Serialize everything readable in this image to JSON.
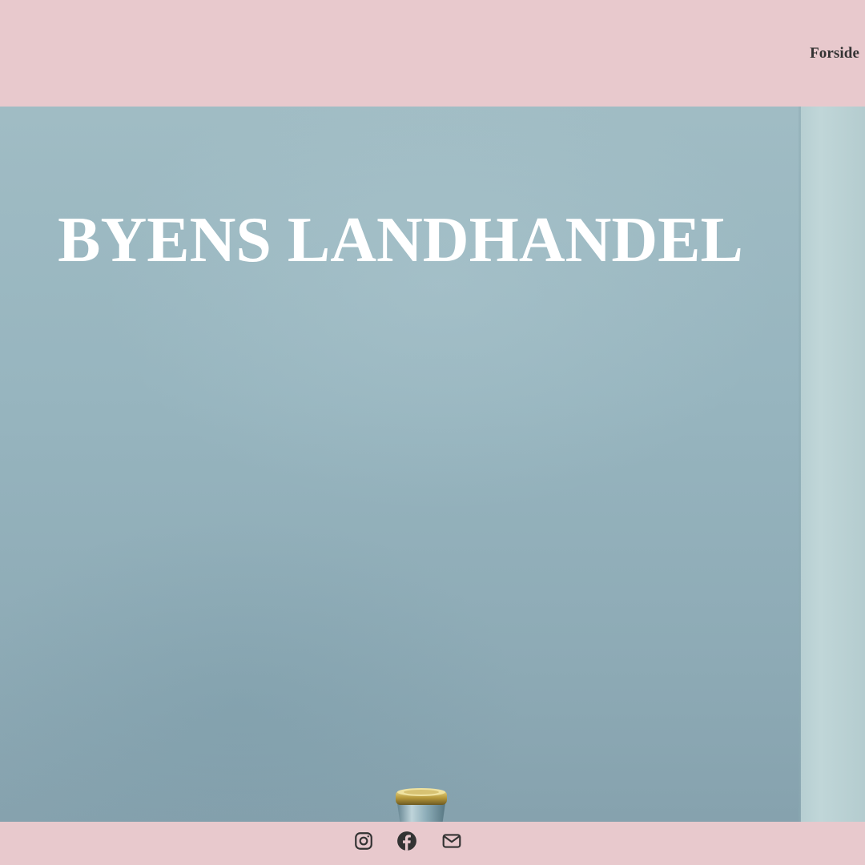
{
  "header": {
    "nav": {
      "home_label": "Forside"
    }
  },
  "hero": {
    "title": "BYENS LANDHANDEL"
  },
  "footer": {
    "social_icons": [
      "instagram-icon",
      "facebook-icon",
      "mail-icon"
    ]
  },
  "colors": {
    "header_bg": "#e8c9cd",
    "footer_bg": "#e8c9cd",
    "hero_bg": "#97b5bf",
    "title_text": "#ffffff",
    "nav_text": "#333333",
    "icon_color": "#333333"
  }
}
